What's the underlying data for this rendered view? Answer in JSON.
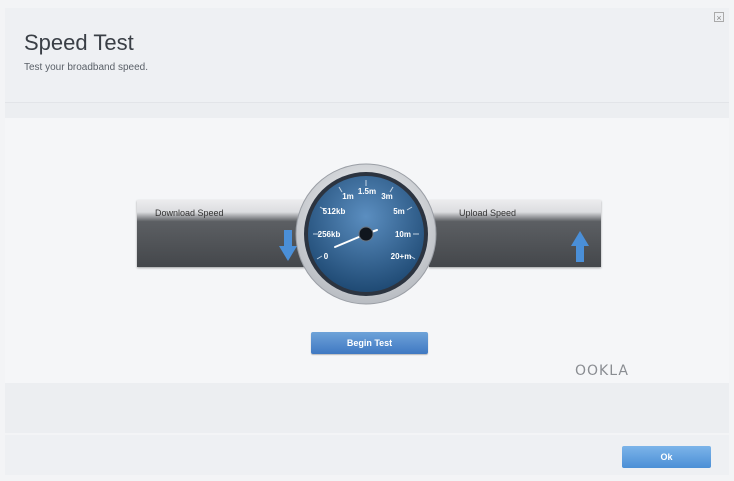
{
  "header": {
    "title": "Speed Test",
    "subtitle": "Test your broadband speed."
  },
  "panels": {
    "download_label": "Download Speed",
    "upload_label": "Upload Speed"
  },
  "gauge": {
    "scale_labels": [
      "0",
      "256kb",
      "512kb",
      "1m",
      "1.5m",
      "3m",
      "5m",
      "10m",
      "20+m"
    ]
  },
  "buttons": {
    "begin_test": "Begin Test",
    "ok": "Ok"
  },
  "branding": {
    "logo": "OOKLA"
  },
  "colors": {
    "accent": "#3f78c2",
    "gauge_face": "#2f5f8e",
    "arrow": "#4a8fd8"
  },
  "icons": {
    "download": "arrow-down-icon",
    "upload": "arrow-up-icon",
    "close": "close-icon"
  }
}
